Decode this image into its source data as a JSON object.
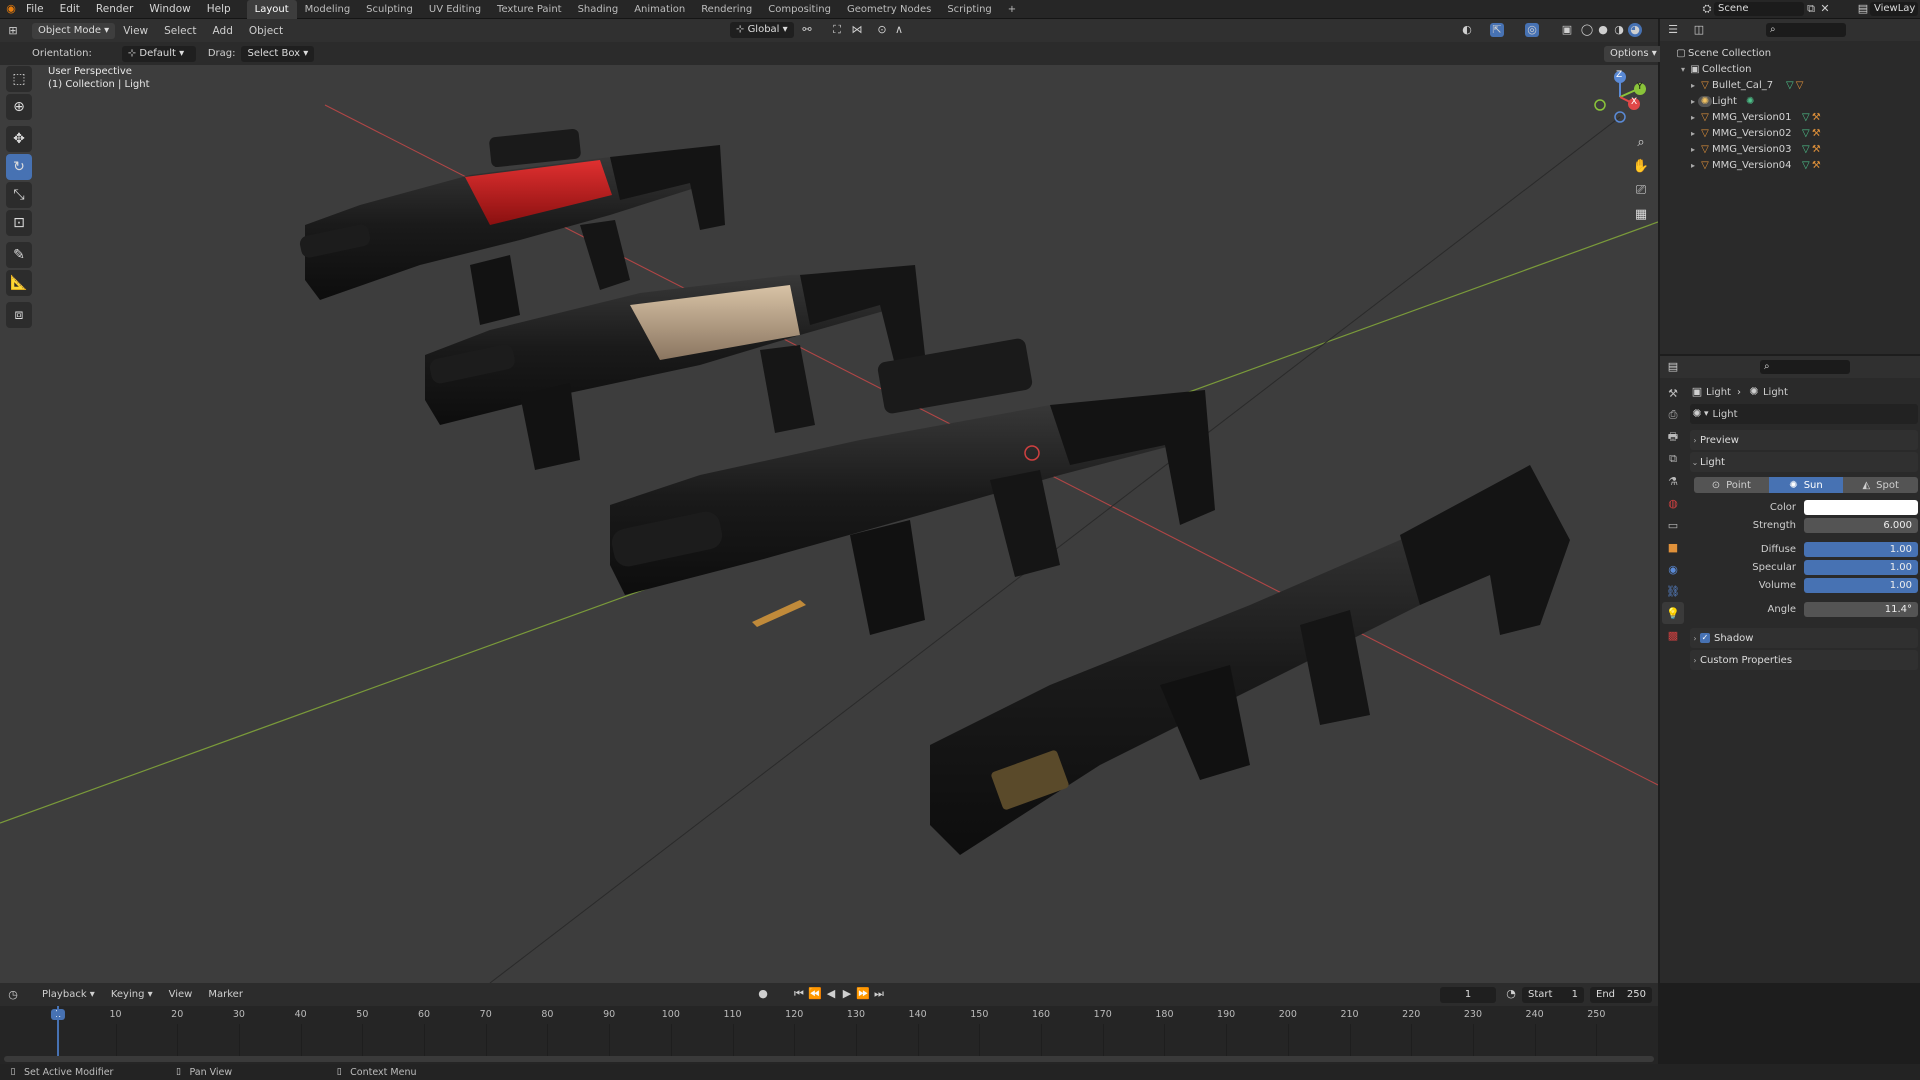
{
  "menubar": {
    "menus": [
      "File",
      "Edit",
      "Render",
      "Window",
      "Help"
    ],
    "workspaces": [
      "Layout",
      "Modeling",
      "Sculpting",
      "UV Editing",
      "Texture Paint",
      "Shading",
      "Animation",
      "Rendering",
      "Compositing",
      "Geometry Nodes",
      "Scripting"
    ],
    "active_workspace": "Layout",
    "add_tab": "+",
    "scene_label": "Scene",
    "viewlayer_label": "ViewLay"
  },
  "viewport_header": {
    "mode": "Object Mode",
    "menus": [
      "View",
      "Select",
      "Add",
      "Object"
    ],
    "transform": "Global",
    "options": "Options"
  },
  "tool_settings": {
    "orientation_label": "Orientation:",
    "orientation_value": "Default",
    "drag_label": "Drag:",
    "drag_value": "Select Box"
  },
  "viewport": {
    "perspective": "User Perspective",
    "context": "(1) Collection | Light",
    "gizmo": {
      "z": "Z",
      "y": "Y",
      "x": "X"
    }
  },
  "outliner": {
    "root": "Scene Collection",
    "collection": "Collection",
    "items": [
      {
        "name": "Bullet_Cal_7"
      },
      {
        "name": "Light"
      },
      {
        "name": "MMG_Version01"
      },
      {
        "name": "MMG_Version02"
      },
      {
        "name": "MMG_Version03"
      },
      {
        "name": "MMG_Version04"
      }
    ]
  },
  "properties": {
    "breadcrumb": [
      "Light",
      "Light"
    ],
    "datablock": "Light",
    "panels": {
      "preview": "Preview",
      "light": "Light",
      "shadow": "Shadow",
      "custom": "Custom Properties"
    },
    "light_types": [
      "Point",
      "Sun",
      "Spot"
    ],
    "active_type": "Sun",
    "fields": [
      {
        "label": "Color",
        "value": ""
      },
      {
        "label": "Strength",
        "value": "6.000"
      },
      {
        "label": "Diffuse",
        "value": "1.00"
      },
      {
        "label": "Specular",
        "value": "1.00"
      },
      {
        "label": "Volume",
        "value": "1.00"
      },
      {
        "label": "Angle",
        "value": "11.4°"
      }
    ],
    "colors": {
      "accent": "#4772b3",
      "color_swatch": "#ffffff"
    }
  },
  "timeline": {
    "menus": [
      "Playback",
      "Keying",
      "View",
      "Marker"
    ],
    "current_frame": "1",
    "start_label": "Start",
    "start_value": "1",
    "end_label": "End",
    "end_value": "250",
    "ticks": [
      "1",
      "10",
      "20",
      "30",
      "40",
      "50",
      "60",
      "70",
      "80",
      "90",
      "100",
      "110",
      "120",
      "130",
      "140",
      "150",
      "160",
      "170",
      "180",
      "190",
      "200",
      "210",
      "220",
      "230",
      "240",
      "250"
    ]
  },
  "statusbar": {
    "items": [
      "Set Active Modifier",
      "Pan View",
      "Context Menu"
    ]
  }
}
